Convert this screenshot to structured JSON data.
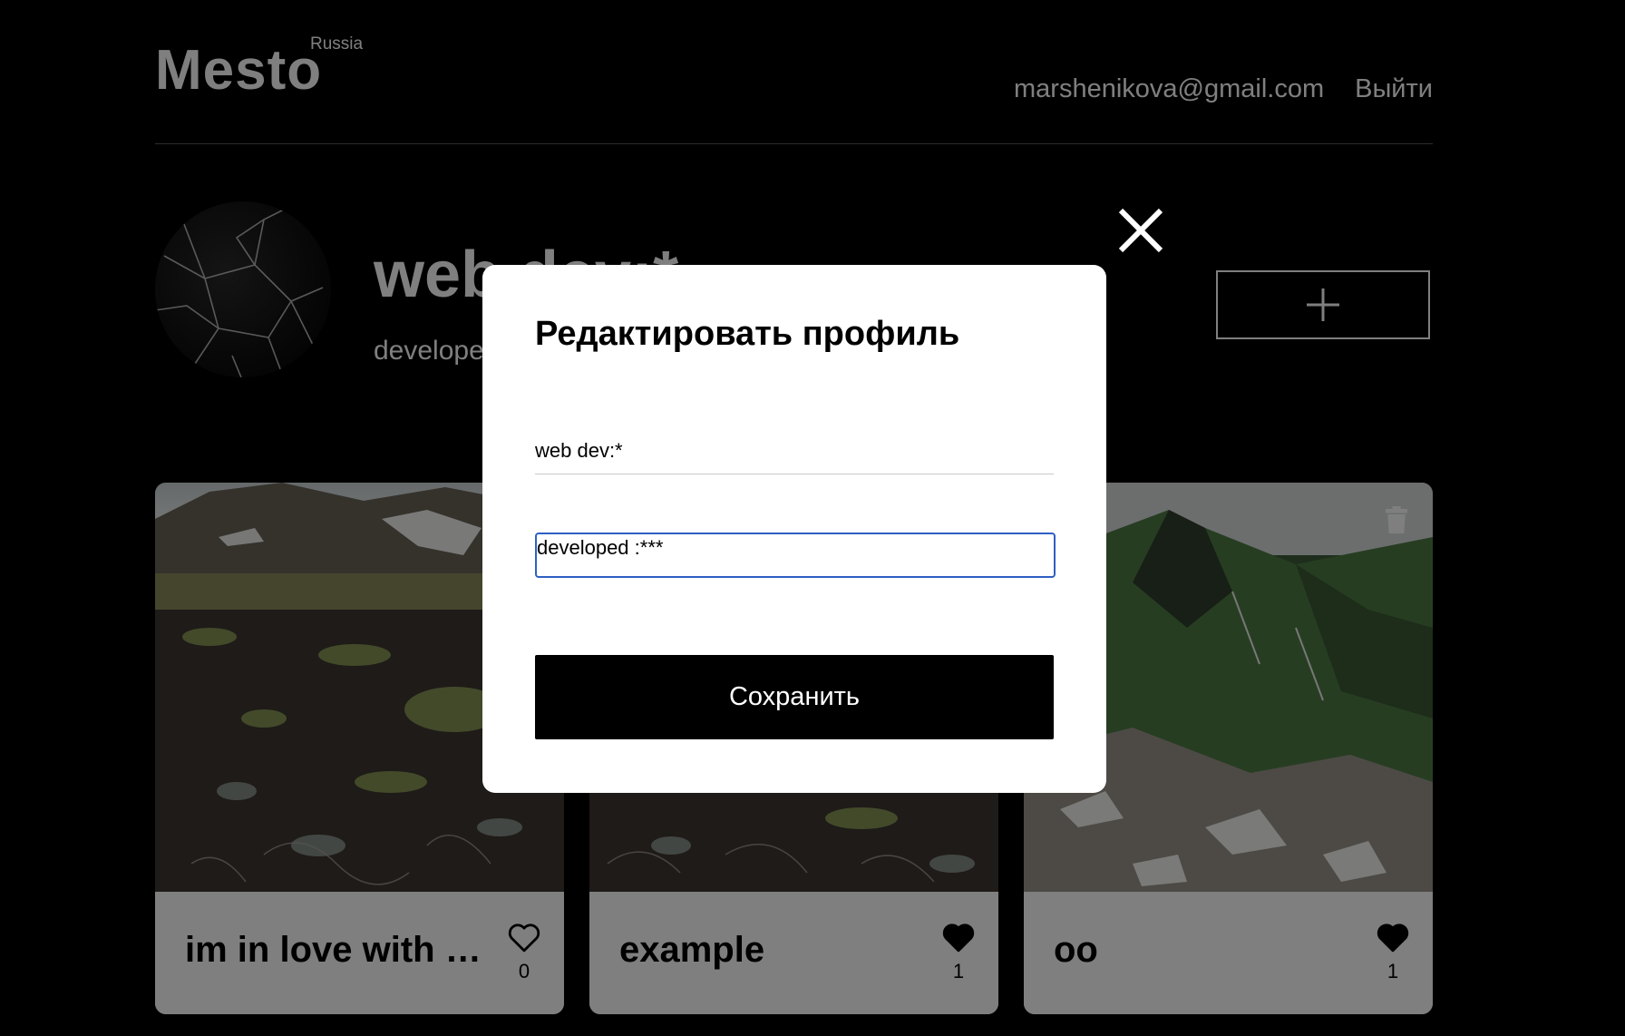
{
  "header": {
    "logo": "Mesto",
    "logo_suffix": "Russia",
    "email": "marshenikova@gmail.com",
    "logout_label": "Выйти"
  },
  "profile": {
    "name": "web dev:*",
    "about": "developed :***"
  },
  "cards": [
    {
      "title": "im in love with mountains",
      "likes": "0",
      "liked": false
    },
    {
      "title": "example",
      "likes": "1",
      "liked": true
    },
    {
      "title": "oo",
      "likes": "1",
      "liked": true
    }
  ],
  "modal": {
    "title": "Редактировать профиль",
    "name_value": "web dev:*",
    "about_value": "developed :***",
    "save_label": "Сохранить"
  },
  "icons": {
    "close": "close-icon",
    "add": "plus-icon",
    "like": "heart-icon",
    "delete": "trash-icon"
  }
}
